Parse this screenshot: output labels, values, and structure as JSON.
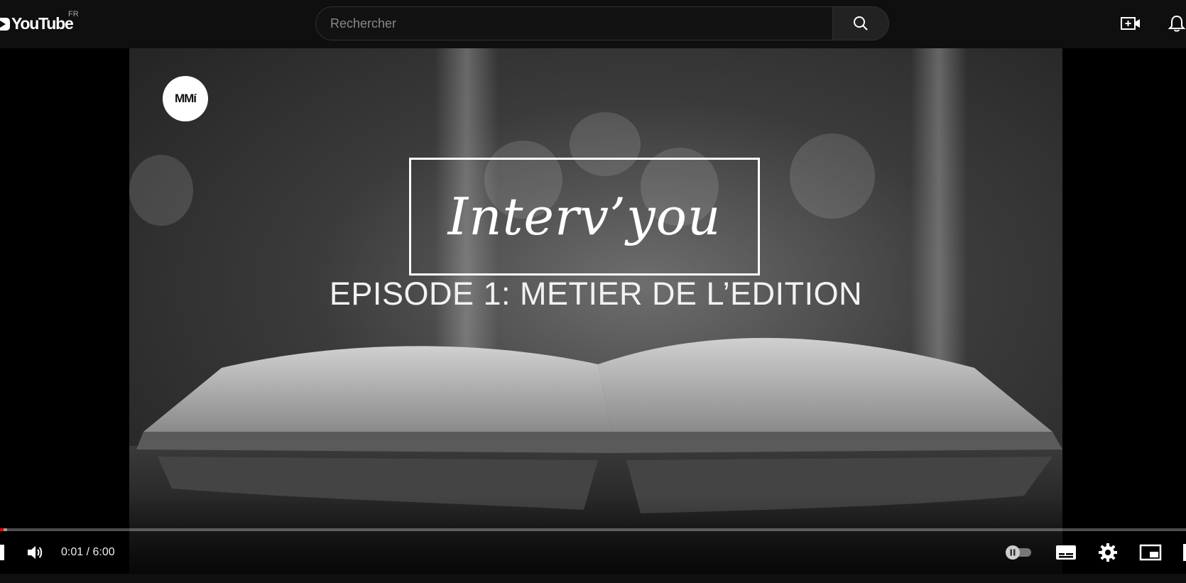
{
  "header": {
    "logo_text": "YouTube",
    "country_code": "FR",
    "search_placeholder": "Rechercher",
    "icons": [
      "search-icon",
      "create-video-icon",
      "notifications-icon"
    ]
  },
  "video": {
    "channel_logo_text": "MMí",
    "title_card": "Interv’you",
    "subtitle_card": "EPISODE 1: METIER DE L’EDITION"
  },
  "player_controls": {
    "current_time": "0:01",
    "separator": " / ",
    "duration": "6:00",
    "progress_fraction": 0.003,
    "icons": [
      "volume-icon",
      "autoplay-toggle-icon",
      "subtitles-icon",
      "settings-icon",
      "miniplayer-icon"
    ]
  },
  "colors": {
    "background": "#0f0f0f",
    "progress_played": "#ff0000"
  }
}
